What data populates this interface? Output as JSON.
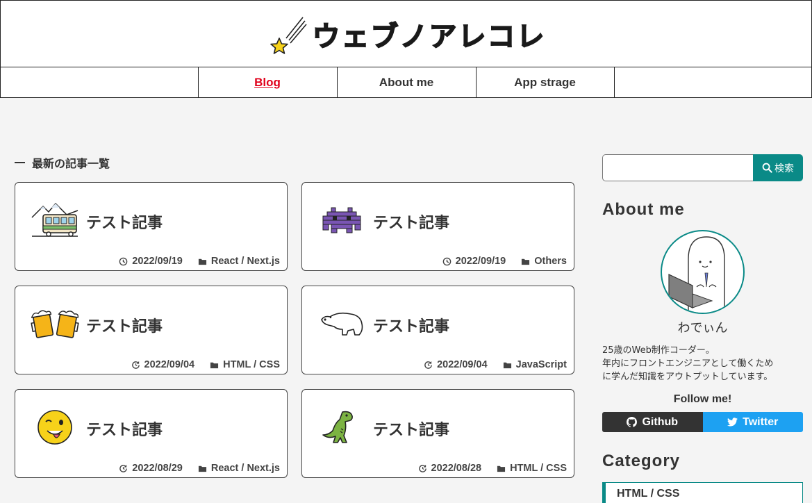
{
  "header": {
    "site_title": "ウェブノアレコレ",
    "logo_icon": "shooting-star-icon"
  },
  "nav": [
    {
      "label": "Blog",
      "active": true
    },
    {
      "label": "About me",
      "active": false
    },
    {
      "label": "App strage",
      "active": false
    }
  ],
  "main": {
    "section_title": "最新の記事一覧",
    "articles": [
      {
        "title": "テスト記事",
        "date": "2022/09/19",
        "date_icon": "clock-icon",
        "category": "React / Next.js",
        "icon": "train-icon"
      },
      {
        "title": "テスト記事",
        "date": "2022/09/19",
        "date_icon": "clock-icon",
        "category": "Others",
        "icon": "space-invader-icon"
      },
      {
        "title": "テスト記事",
        "date": "2022/09/04",
        "date_icon": "update-icon",
        "category": "HTML / CSS",
        "icon": "beer-mugs-icon"
      },
      {
        "title": "テスト記事",
        "date": "2022/09/04",
        "date_icon": "update-icon",
        "category": "JavaScript",
        "icon": "polar-bear-icon"
      },
      {
        "title": "テスト記事",
        "date": "2022/08/29",
        "date_icon": "update-icon",
        "category": "React / Next.js",
        "icon": "winking-face-icon"
      },
      {
        "title": "テスト記事",
        "date": "2022/08/28",
        "date_icon": "update-icon",
        "category": "HTML / CSS",
        "icon": "dinosaur-icon"
      }
    ]
  },
  "sidebar": {
    "search": {
      "placeholder": "",
      "button_label": "検索"
    },
    "about_title": "About me",
    "profile_name": "わでぃん",
    "bio_lines": [
      "25歳のWeb制作コーダー。",
      "年内にフロントエンジニアとして働くため",
      "に学んだ知識をアウトプットしています。"
    ],
    "follow_label": "Follow me!",
    "social": [
      {
        "label": "Github",
        "icon": "github-icon"
      },
      {
        "label": "Twitter",
        "icon": "twitter-icon"
      }
    ],
    "category_title": "Category",
    "categories": [
      "HTML / CSS"
    ]
  },
  "colors": {
    "accent": "#0a8a87",
    "active_nav": "#e0001b",
    "github": "#333333",
    "twitter": "#1da1f2",
    "background": "#f4f4f4"
  }
}
